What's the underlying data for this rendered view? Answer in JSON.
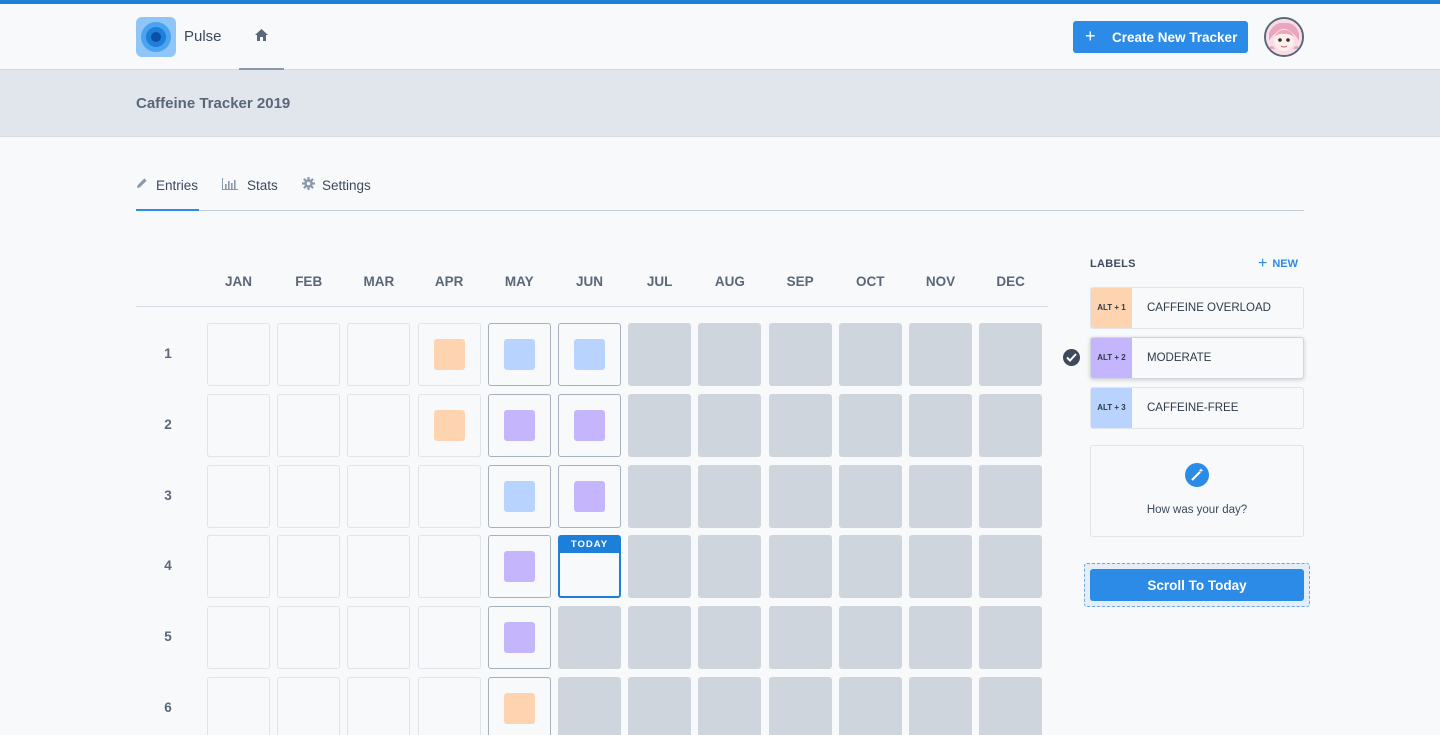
{
  "app": {
    "brand": "Pulse",
    "create_button_label": "Create New Tracker",
    "create_button_icon": "plus-icon",
    "home_icon": "home-icon"
  },
  "tracker": {
    "title": "Caffeine Tracker 2019"
  },
  "tabs": [
    {
      "label": "Entries",
      "icon": "pencil-icon",
      "active": true
    },
    {
      "label": "Stats",
      "icon": "bar-chart-icon",
      "active": false
    },
    {
      "label": "Settings",
      "icon": "gear-icon",
      "active": false
    }
  ],
  "months": [
    "JAN",
    "FEB",
    "MAR",
    "APR",
    "MAY",
    "JUN",
    "JUL",
    "AUG",
    "SEP",
    "OCT",
    "NOV",
    "DEC"
  ],
  "rows": [
    "1",
    "2",
    "3",
    "4",
    "5",
    "6"
  ],
  "grid": [
    [
      "empty",
      "empty",
      "empty",
      "overload",
      "caffeine-free",
      "caffeine-free",
      "future",
      "future",
      "future",
      "future",
      "future",
      "future"
    ],
    [
      "empty",
      "empty",
      "empty",
      "overload",
      "moderate",
      "moderate",
      "future",
      "future",
      "future",
      "future",
      "future",
      "future"
    ],
    [
      "empty",
      "empty",
      "empty",
      "empty",
      "caffeine-free",
      "moderate",
      "future",
      "future",
      "future",
      "future",
      "future",
      "future"
    ],
    [
      "empty",
      "empty",
      "empty",
      "empty",
      "moderate",
      "today",
      "future",
      "future",
      "future",
      "future",
      "future",
      "future"
    ],
    [
      "empty",
      "empty",
      "empty",
      "empty",
      "moderate",
      "future",
      "future",
      "future",
      "future",
      "future",
      "future",
      "future"
    ],
    [
      "empty",
      "empty",
      "empty",
      "empty",
      "overload",
      "future",
      "future",
      "future",
      "future",
      "future",
      "future",
      "future"
    ]
  ],
  "today_label": "TODAY",
  "colors": {
    "overload": "#fed4b0",
    "moderate": "#c4b5fd",
    "caffeine-free": "#b8d3fe",
    "accent": "#2b8be6",
    "future": "#ced5dc"
  },
  "labels_panel": {
    "heading": "LABELS",
    "new_label": "NEW",
    "items": [
      {
        "shortcut": "ALT + 1",
        "name": "CAFFEINE OVERLOAD",
        "color": "#fed4b0",
        "selected": false
      },
      {
        "shortcut": "ALT + 2",
        "name": "MODERATE",
        "color": "#c4b5fd",
        "selected": true
      },
      {
        "shortcut": "ALT + 3",
        "name": "CAFFEINE-FREE",
        "color": "#b8d3fe",
        "selected": false
      }
    ],
    "selected_icon": "check-circle-icon",
    "prompt_icon": "magic-wand-icon",
    "prompt_text": "How was your day?",
    "scroll_button_label": "Scroll To Today"
  }
}
